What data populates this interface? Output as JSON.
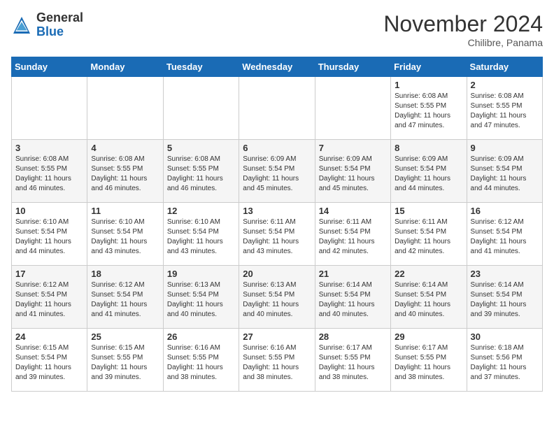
{
  "logo": {
    "line1": "General",
    "line2": "Blue"
  },
  "title": "November 2024",
  "subtitle": "Chilibre, Panama",
  "days_of_week": [
    "Sunday",
    "Monday",
    "Tuesday",
    "Wednesday",
    "Thursday",
    "Friday",
    "Saturday"
  ],
  "weeks": [
    [
      {
        "day": "",
        "info": ""
      },
      {
        "day": "",
        "info": ""
      },
      {
        "day": "",
        "info": ""
      },
      {
        "day": "",
        "info": ""
      },
      {
        "day": "",
        "info": ""
      },
      {
        "day": "1",
        "info": "Sunrise: 6:08 AM\nSunset: 5:55 PM\nDaylight: 11 hours and 47 minutes."
      },
      {
        "day": "2",
        "info": "Sunrise: 6:08 AM\nSunset: 5:55 PM\nDaylight: 11 hours and 47 minutes."
      }
    ],
    [
      {
        "day": "3",
        "info": "Sunrise: 6:08 AM\nSunset: 5:55 PM\nDaylight: 11 hours and 46 minutes."
      },
      {
        "day": "4",
        "info": "Sunrise: 6:08 AM\nSunset: 5:55 PM\nDaylight: 11 hours and 46 minutes."
      },
      {
        "day": "5",
        "info": "Sunrise: 6:08 AM\nSunset: 5:55 PM\nDaylight: 11 hours and 46 minutes."
      },
      {
        "day": "6",
        "info": "Sunrise: 6:09 AM\nSunset: 5:54 PM\nDaylight: 11 hours and 45 minutes."
      },
      {
        "day": "7",
        "info": "Sunrise: 6:09 AM\nSunset: 5:54 PM\nDaylight: 11 hours and 45 minutes."
      },
      {
        "day": "8",
        "info": "Sunrise: 6:09 AM\nSunset: 5:54 PM\nDaylight: 11 hours and 44 minutes."
      },
      {
        "day": "9",
        "info": "Sunrise: 6:09 AM\nSunset: 5:54 PM\nDaylight: 11 hours and 44 minutes."
      }
    ],
    [
      {
        "day": "10",
        "info": "Sunrise: 6:10 AM\nSunset: 5:54 PM\nDaylight: 11 hours and 44 minutes."
      },
      {
        "day": "11",
        "info": "Sunrise: 6:10 AM\nSunset: 5:54 PM\nDaylight: 11 hours and 43 minutes."
      },
      {
        "day": "12",
        "info": "Sunrise: 6:10 AM\nSunset: 5:54 PM\nDaylight: 11 hours and 43 minutes."
      },
      {
        "day": "13",
        "info": "Sunrise: 6:11 AM\nSunset: 5:54 PM\nDaylight: 11 hours and 43 minutes."
      },
      {
        "day": "14",
        "info": "Sunrise: 6:11 AM\nSunset: 5:54 PM\nDaylight: 11 hours and 42 minutes."
      },
      {
        "day": "15",
        "info": "Sunrise: 6:11 AM\nSunset: 5:54 PM\nDaylight: 11 hours and 42 minutes."
      },
      {
        "day": "16",
        "info": "Sunrise: 6:12 AM\nSunset: 5:54 PM\nDaylight: 11 hours and 41 minutes."
      }
    ],
    [
      {
        "day": "17",
        "info": "Sunrise: 6:12 AM\nSunset: 5:54 PM\nDaylight: 11 hours and 41 minutes."
      },
      {
        "day": "18",
        "info": "Sunrise: 6:12 AM\nSunset: 5:54 PM\nDaylight: 11 hours and 41 minutes."
      },
      {
        "day": "19",
        "info": "Sunrise: 6:13 AM\nSunset: 5:54 PM\nDaylight: 11 hours and 40 minutes."
      },
      {
        "day": "20",
        "info": "Sunrise: 6:13 AM\nSunset: 5:54 PM\nDaylight: 11 hours and 40 minutes."
      },
      {
        "day": "21",
        "info": "Sunrise: 6:14 AM\nSunset: 5:54 PM\nDaylight: 11 hours and 40 minutes."
      },
      {
        "day": "22",
        "info": "Sunrise: 6:14 AM\nSunset: 5:54 PM\nDaylight: 11 hours and 40 minutes."
      },
      {
        "day": "23",
        "info": "Sunrise: 6:14 AM\nSunset: 5:54 PM\nDaylight: 11 hours and 39 minutes."
      }
    ],
    [
      {
        "day": "24",
        "info": "Sunrise: 6:15 AM\nSunset: 5:54 PM\nDaylight: 11 hours and 39 minutes."
      },
      {
        "day": "25",
        "info": "Sunrise: 6:15 AM\nSunset: 5:55 PM\nDaylight: 11 hours and 39 minutes."
      },
      {
        "day": "26",
        "info": "Sunrise: 6:16 AM\nSunset: 5:55 PM\nDaylight: 11 hours and 38 minutes."
      },
      {
        "day": "27",
        "info": "Sunrise: 6:16 AM\nSunset: 5:55 PM\nDaylight: 11 hours and 38 minutes."
      },
      {
        "day": "28",
        "info": "Sunrise: 6:17 AM\nSunset: 5:55 PM\nDaylight: 11 hours and 38 minutes."
      },
      {
        "day": "29",
        "info": "Sunrise: 6:17 AM\nSunset: 5:55 PM\nDaylight: 11 hours and 38 minutes."
      },
      {
        "day": "30",
        "info": "Sunrise: 6:18 AM\nSunset: 5:56 PM\nDaylight: 11 hours and 37 minutes."
      }
    ]
  ]
}
